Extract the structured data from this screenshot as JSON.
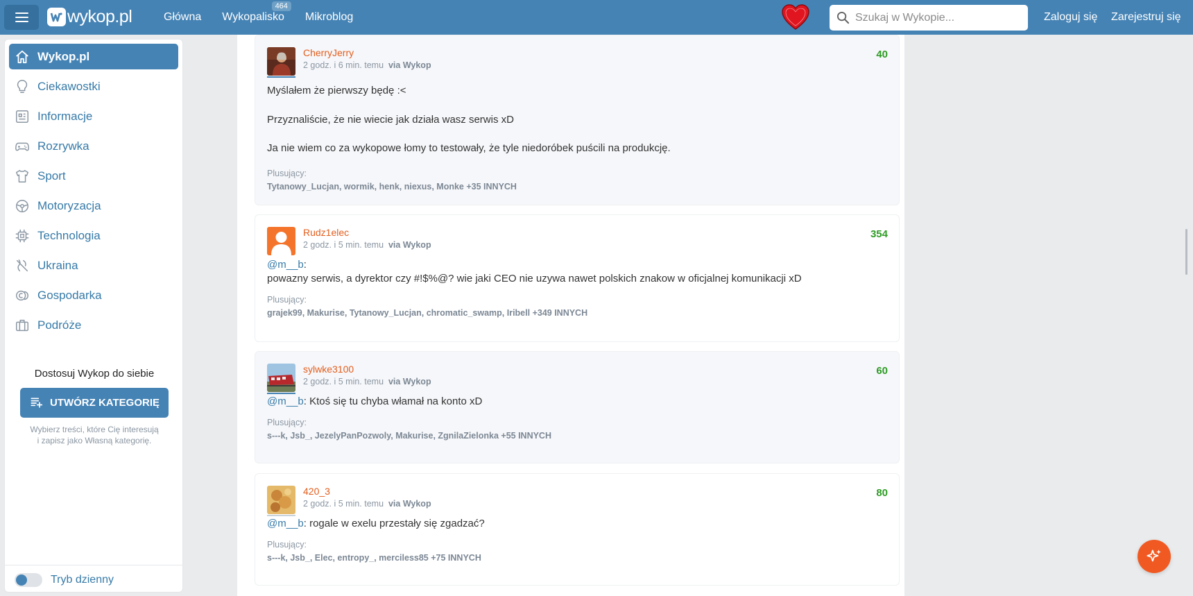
{
  "header": {
    "logo_text": "wykop.pl",
    "nav": [
      {
        "label": "Główna"
      },
      {
        "label": "Wykopalisko",
        "badge": "464"
      },
      {
        "label": "Mikroblog"
      }
    ],
    "heart_label": "wielka orkiestra świątecznej pomocy",
    "search_placeholder": "Szukaj w Wykopie...",
    "login": "Zaloguj się",
    "register": "Zarejestruj się"
  },
  "sidebar": {
    "items": [
      {
        "label": "Wykop.pl",
        "icon": "home-icon",
        "active": true
      },
      {
        "label": "Ciekawostki",
        "icon": "lightbulb-icon"
      },
      {
        "label": "Informacje",
        "icon": "news-icon"
      },
      {
        "label": "Rozrywka",
        "icon": "gamepad-icon"
      },
      {
        "label": "Sport",
        "icon": "shirt-icon"
      },
      {
        "label": "Motoryzacja",
        "icon": "steering-wheel-icon"
      },
      {
        "label": "Technologia",
        "icon": "chip-icon"
      },
      {
        "label": "Ukraina",
        "icon": "ukraine-icon"
      },
      {
        "label": "Gospodarka",
        "icon": "coins-icon"
      },
      {
        "label": "Podróże",
        "icon": "luggage-icon"
      }
    ],
    "custom_title": "Dostosuj Wykop do siebie",
    "create_button": "UTWÓRZ KATEGORIĘ",
    "custom_desc_1": "Wybierz treści, które Cię interesują",
    "custom_desc_2": "i zapisz jako Własną kategorię.",
    "theme_label": "Tryb dzienny"
  },
  "comments": [
    {
      "author": "CherryJerry",
      "time": "2 godz. i 6 min. temu",
      "via": "via Wykop",
      "score": "40",
      "lines": [
        "Myślałem że pierwszy będę :<",
        "Przyznaliście, że nie wiecie jak działa wasz serwis xD",
        "Ja nie wiem co za wykopowe łomy to testowały, że tyle niedoróbek puścili na produkcję."
      ],
      "plus_label": "Plusujący:",
      "plus_names": "Tytanowy_Lucjan, wormik, henk, niexus, Monke",
      "plus_more": "+35 INNYCH"
    },
    {
      "author": "Rudz1elec",
      "time": "2 godz. i 5 min. temu",
      "via": "via Wykop",
      "score": "354",
      "mention": "@m__b",
      "mention_suffix": ":",
      "line": "powazny serwis, a dyrektor czy #!$%@? wie jaki CEO nie uzywa nawet polskich znakow w oficjalnej komunikacji xD",
      "plus_label": "Plusujący:",
      "plus_names": "grajek99, Makurise, Tytanowy_Lucjan, chromatic_swamp, Iribell",
      "plus_more": "+349 INNYCH"
    },
    {
      "author": "sylwke3100",
      "time": "2 godz. i 5 min. temu",
      "via": "via Wykop",
      "score": "60",
      "mention": "@m__b",
      "text": ": Ktoś się tu chyba włamał na konto xD",
      "plus_label": "Plusujący:",
      "plus_names": "s---k, Jsb_, JezelyPanPozwoly, Makurise, ZgnilaZielonka",
      "plus_more": "+55 INNYCH"
    },
    {
      "author": "420_3",
      "time": "2 godz. i 5 min. temu",
      "via": "via Wykop",
      "score": "80",
      "mention": "@m__b",
      "text": ": rogale w exelu przestały się zgadzać?",
      "plus_label": "Plusujący:",
      "plus_names": "s---k, Jsb_, Elec, entropy_, merciless85",
      "plus_more": "+75 INNYCH"
    }
  ],
  "colors": {
    "brand": "#4583b5",
    "author": "#e35d1c",
    "score": "#2f9c26",
    "fab": "#f05a22"
  }
}
